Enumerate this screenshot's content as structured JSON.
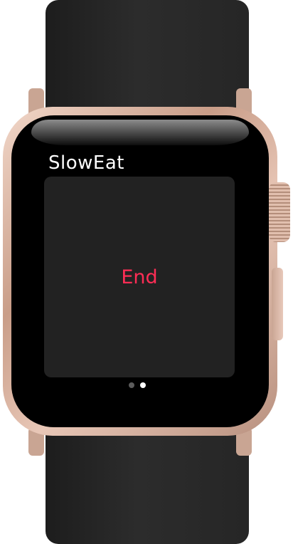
{
  "app": {
    "title": "SlowEat"
  },
  "main": {
    "action_label": "End"
  },
  "pager": {
    "page_count": 2,
    "active_page": 2
  },
  "colors": {
    "accent": "#ff2d55",
    "card": "#222222",
    "screen": "#000000"
  }
}
